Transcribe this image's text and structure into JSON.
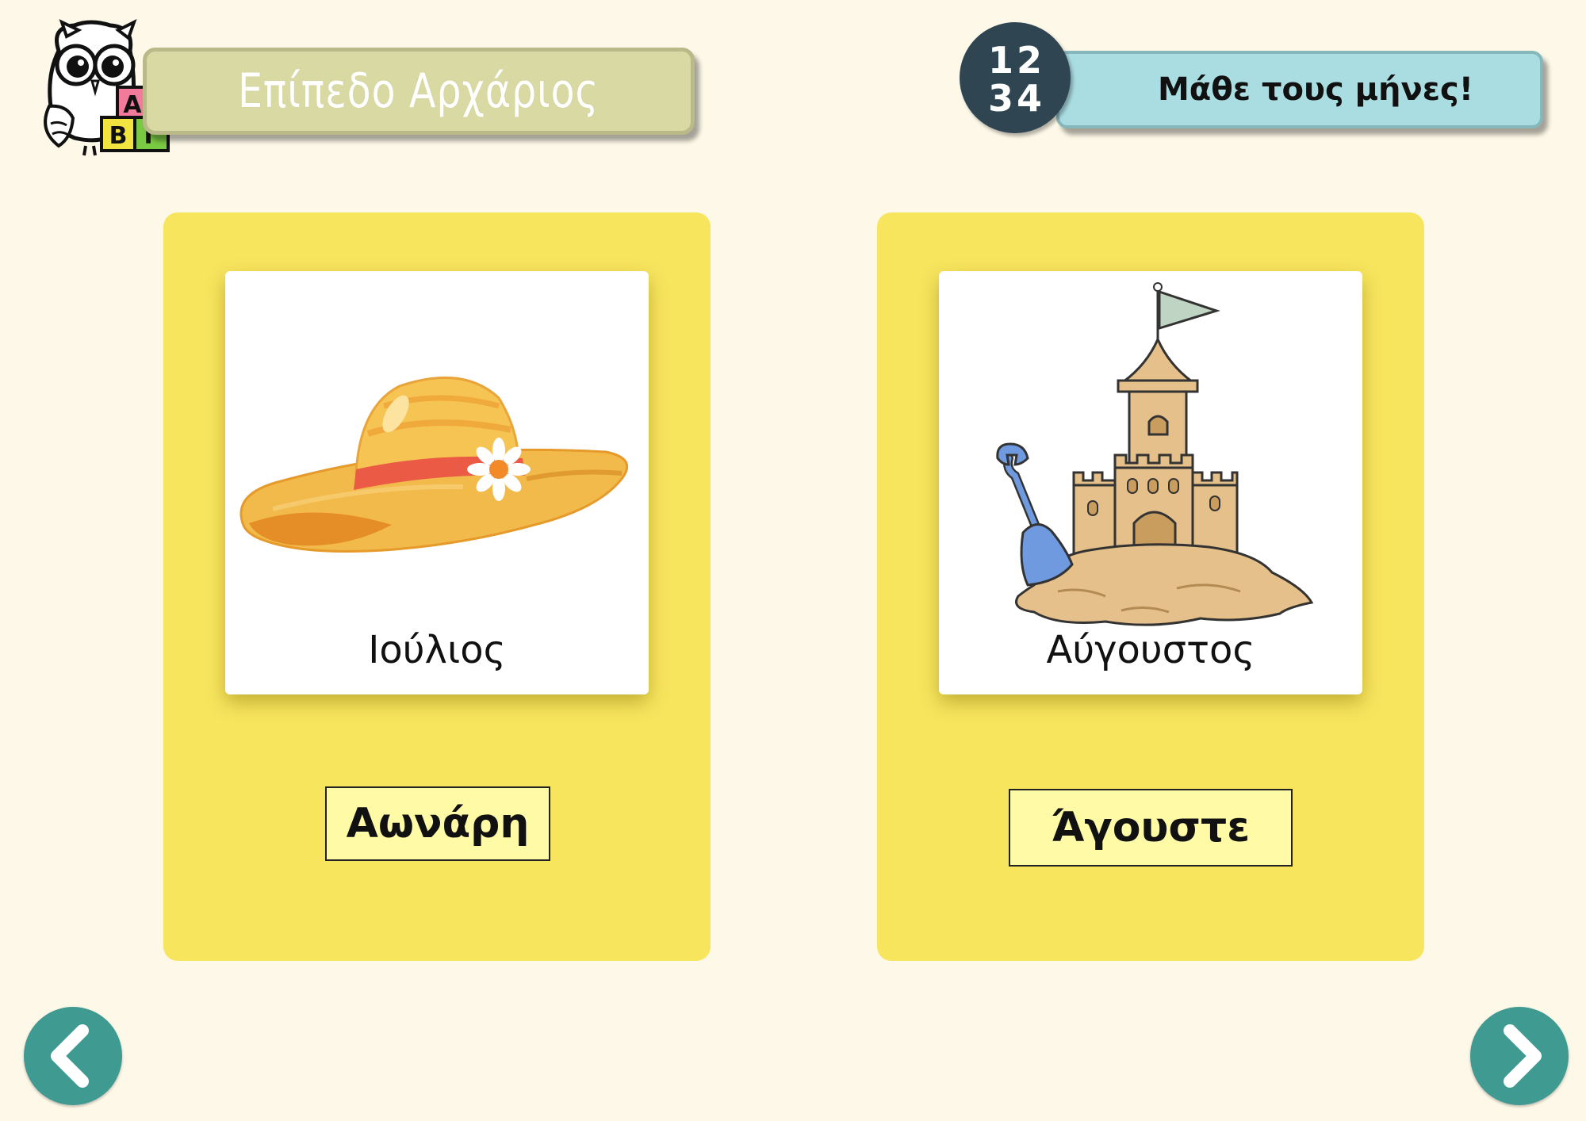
{
  "header": {
    "level_label": "Επίπεδο Αρχάριος",
    "logo_letters": [
      "Α",
      "Β",
      "Γ"
    ],
    "badge_digits": [
      "1",
      "2",
      "3",
      "4"
    ],
    "activity_title": "Μάθε τους μήνες!"
  },
  "cards": [
    {
      "image_icon": "straw-hat",
      "month": "Ιούλιος",
      "answer": "Αωνάρη"
    },
    {
      "image_icon": "sandcastle",
      "month": "Αύγουστος",
      "answer": "Άγουστε"
    }
  ],
  "navigation": {
    "prev_icon": "chevron-left-icon",
    "next_icon": "chevron-right-icon"
  },
  "colors": {
    "background": "#fdf8e8",
    "card": "#f8e55e",
    "answer_box": "#fffaa6",
    "level_banner": "#d9d9a3",
    "title_banner": "#a9dde2",
    "nav_button": "#3f9a92"
  }
}
